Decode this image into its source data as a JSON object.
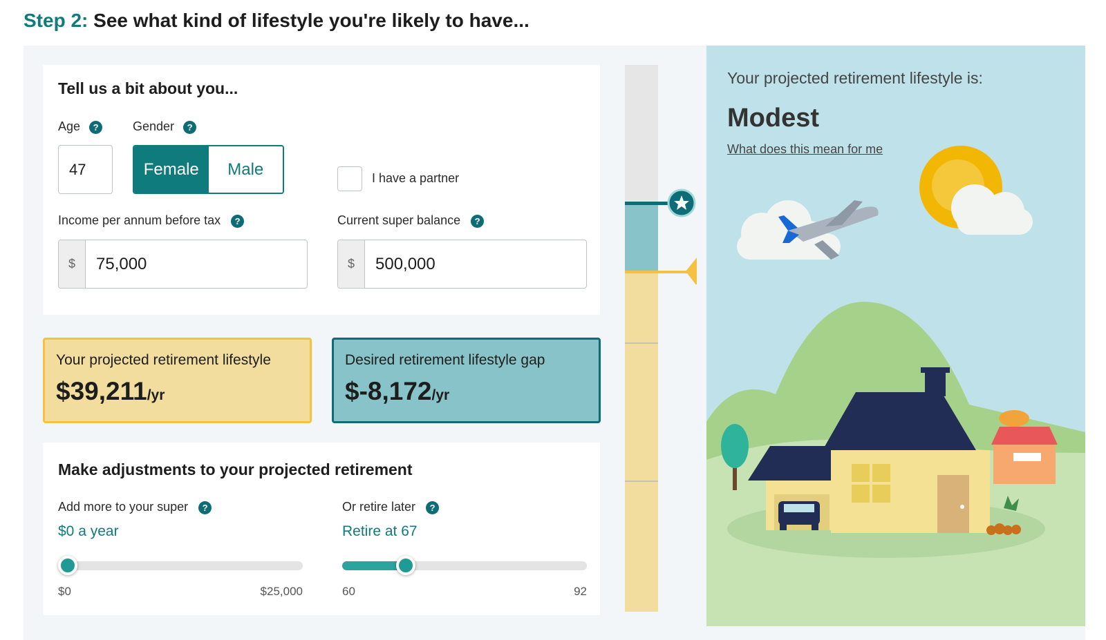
{
  "step": {
    "number": "Step 2:",
    "title": "See what kind of lifestyle you're likely to have..."
  },
  "about": {
    "heading": "Tell us a bit about you...",
    "age_label": "Age",
    "age_value": "47",
    "gender_label": "Gender",
    "gender_options": [
      "Female",
      "Male"
    ],
    "gender_selected": "Female",
    "partner_label": "I have a partner",
    "partner_checked": false,
    "income_label": "Income per annum before tax",
    "income_prefix": "$",
    "income_value": "75,000",
    "super_label": "Current super balance",
    "super_prefix": "$",
    "super_value": "500,000",
    "help_glyph": "?"
  },
  "results": {
    "projected_label": "Your projected retirement lifestyle",
    "projected_value": "$39,211",
    "projected_unit": "/yr",
    "gap_label": "Desired retirement lifestyle gap",
    "gap_value": "$-8,172",
    "gap_unit": "/yr"
  },
  "adjust": {
    "heading": "Make adjustments to your projected retirement",
    "super_label": "Add more to your super",
    "super_value": "$0 a year",
    "super_min": "$0",
    "super_max": "$25,000",
    "super_fraction": 0,
    "retire_label": "Or retire later",
    "retire_value": "Retire at 67",
    "retire_min": "60",
    "retire_max": "92",
    "retire_fraction": 0.24
  },
  "lifestyle": {
    "title": "Your projected retirement lifestyle is:",
    "level": "Modest",
    "link": "What does this mean for me"
  },
  "gauge": {
    "star_icon": "star-icon",
    "marker_icon": "triangle-marker-icon"
  },
  "colors": {
    "brand_teal": "#0f7b7c",
    "projected_yellow": "#f2dd9e",
    "gap_teal": "#87c3c8",
    "sky": "#bfe2ea"
  }
}
